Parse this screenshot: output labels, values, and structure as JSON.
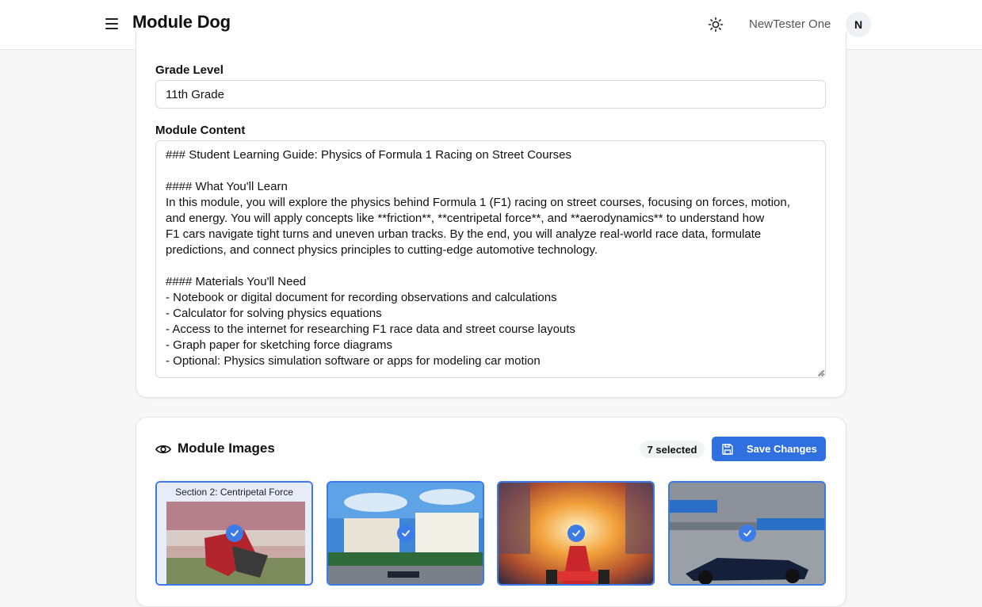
{
  "header": {
    "app_title": "Module Dog",
    "user_name": "NewTester One",
    "avatar_initial": "N"
  },
  "form": {
    "grade_label": "Grade Level",
    "grade_value": "11th Grade",
    "content_label": "Module Content",
    "content_lines": [
      "### Student Learning Guide: Physics of Formula 1 Racing on Street Courses",
      "",
      "#### What You'll Learn",
      "In this module, you will explore the physics behind Formula 1 (F1) racing on street courses, focusing on forces, motion,",
      "and energy. You will apply concepts like **friction**, **centripetal force**, and **aerodynamics** to understand how",
      "F1 cars navigate tight turns and uneven urban tracks. By the end, you will analyze real-world race data, formulate",
      "predictions, and connect physics principles to cutting-edge automotive technology.",
      "",
      "#### Materials You'll Need",
      "- Notebook or digital document for recording observations and calculations",
      "- Calculator for solving physics equations",
      "- Access to the internet for researching F1 race data and street course layouts",
      "- Graph paper for sketching force diagrams",
      "- Optional: Physics simulation software or apps for modeling car motion"
    ]
  },
  "images": {
    "title": "Module Images",
    "selected_count": "7 selected",
    "save_label": "Save Changes",
    "thumbs": [
      {
        "caption": "Section 2: Centripetal Force",
        "selected": true
      },
      {
        "caption": "",
        "selected": true
      },
      {
        "caption": "",
        "selected": true
      },
      {
        "caption": "",
        "selected": true
      }
    ]
  },
  "colors": {
    "accent": "#2f6fe0",
    "selection_border": "#3b7be8"
  }
}
